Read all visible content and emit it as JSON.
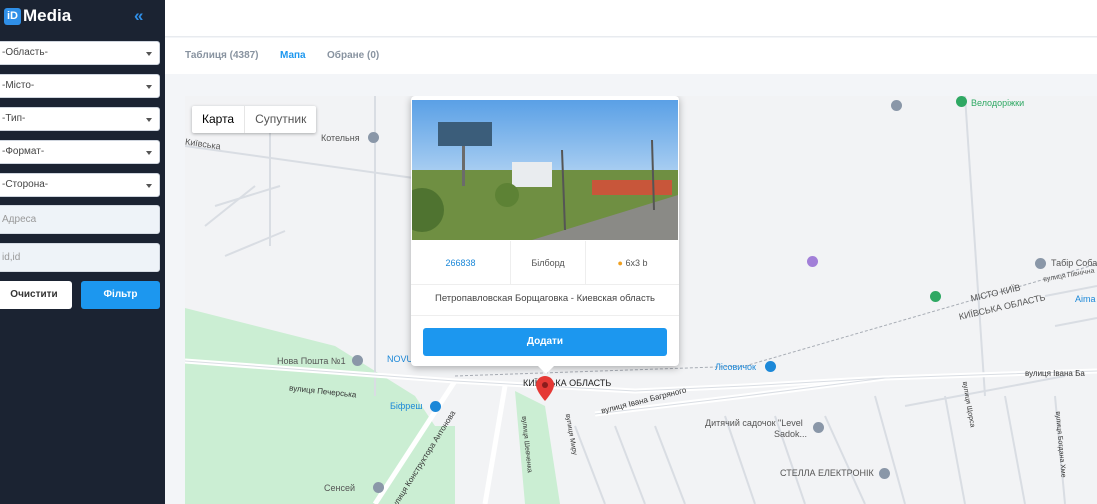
{
  "app": {
    "logo_mark": "iD",
    "logo_text": "Media",
    "collapse_icon": "double-chevron-left-icon"
  },
  "filters": {
    "region": "-Область-",
    "city": "-Місто-",
    "type": "-Тип-",
    "format": "-Формат-",
    "side": "-Сторона-",
    "address_placeholder": "Адресa",
    "id_placeholder": "id,id",
    "clear_label": "Очистити",
    "filter_label": "Фільтр"
  },
  "tabs": [
    {
      "label": "Таблиця (4387)"
    },
    {
      "label": "Мапа"
    },
    {
      "label": "Обране (0)"
    }
  ],
  "map": {
    "map_type_options": [
      "Карта",
      "Супутник"
    ],
    "labels": {
      "kotelnya": "Котельня",
      "velodorizhky": "Велодоріжки",
      "misto_kyiv": "МІСТО КИЇВ",
      "kyivska_oblast_ne": "КИЇВСЬКА ОБЛАСТЬ",
      "tabir": "Табір Соба",
      "aima": "Aima",
      "nova_poshta": "Нова Пошта №1",
      "novus": "NOVU",
      "kyivska_oblast": "КИЇВСЬКА ОБЛАСТЬ",
      "vul_pecherska": "вулиця Печерська",
      "bifresh": "Біфреш",
      "lisovychok": "Лісовичок",
      "vul_ivana_bagr": "вулиця Івана Багряного",
      "vul_ivana_bagr_e": "вулиця Івана Ба",
      "dytiachyi": "Дитячий садочок \"Level",
      "sadok": "Sadok...",
      "stella": "СТЕЛЛА ЕЛЕКТРОНІК",
      "sensei": "Сенсей",
      "konstruktora": "вулиця Конструктора Антонова",
      "shevchenka": "вулиця Шевченка",
      "myru": "вулиця Миру",
      "vul_tsorsa": "вулиця Щорса",
      "vul_bohdana": "вулиця Богдана Хме",
      "vul_pivnichna": "вулиця Північна",
      "kyivska": "Київська"
    }
  },
  "popup": {
    "id": "266838",
    "type": "Білборд",
    "size": "6x3 b",
    "address": "Петропавловская Борщаговка - Киевская область",
    "add_label": "Додати"
  }
}
